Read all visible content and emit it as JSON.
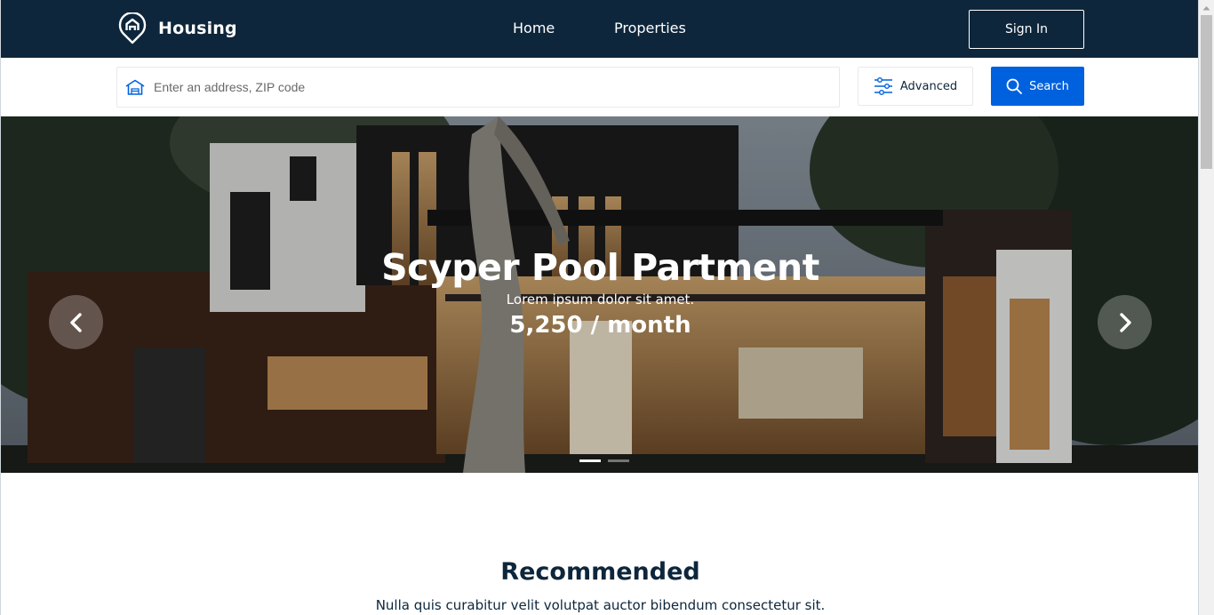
{
  "header": {
    "brand": "Housing",
    "nav": {
      "home": "Home",
      "properties": "Properties"
    },
    "sign_in": "Sign In"
  },
  "search": {
    "placeholder": "Enter an address, ZIP code",
    "value": "",
    "advanced_label": "Advanced",
    "search_label": "Search"
  },
  "hero": {
    "title": "Scyper Pool Partment",
    "subtitle": "Lorem ipsum dolor sit amet.",
    "price": "5,250 / month",
    "slide_count": 2,
    "active_slide": 1
  },
  "recommended": {
    "title": "Recommended",
    "subtitle": "Nulla quis curabitur velit volutpat auctor bibendum consectetur sit."
  },
  "colors": {
    "navy": "#0d263b",
    "primary_blue": "#0061df",
    "white": "#ffffff"
  },
  "icons": {
    "logo": "location-home-pin-icon",
    "search_field": "house-icon",
    "advanced": "sliders-icon",
    "search": "magnifier-icon",
    "prev": "chevron-left-icon",
    "next": "chevron-right-icon"
  }
}
